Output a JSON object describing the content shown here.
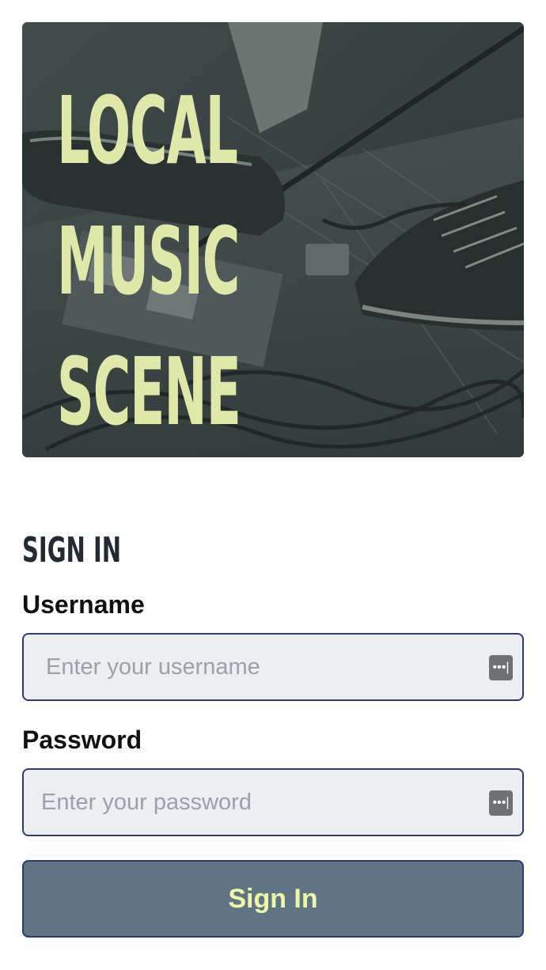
{
  "hero": {
    "title_lines": [
      "LOCAL",
      "MUSIC",
      "SCENE"
    ]
  },
  "signin": {
    "heading": "SIGN IN",
    "username_label": "Username",
    "username_placeholder": "Enter your username",
    "password_label": "Password",
    "password_placeholder": "Enter your password",
    "submit_label": "Sign In",
    "password_manager_icon": "password-manager-icon"
  },
  "colors": {
    "hero_text": "#dfe8a8",
    "field_border": "#2b3b73",
    "field_bg": "#eceef2",
    "button_bg": "#5f7583",
    "button_text": "#eef7a8"
  }
}
